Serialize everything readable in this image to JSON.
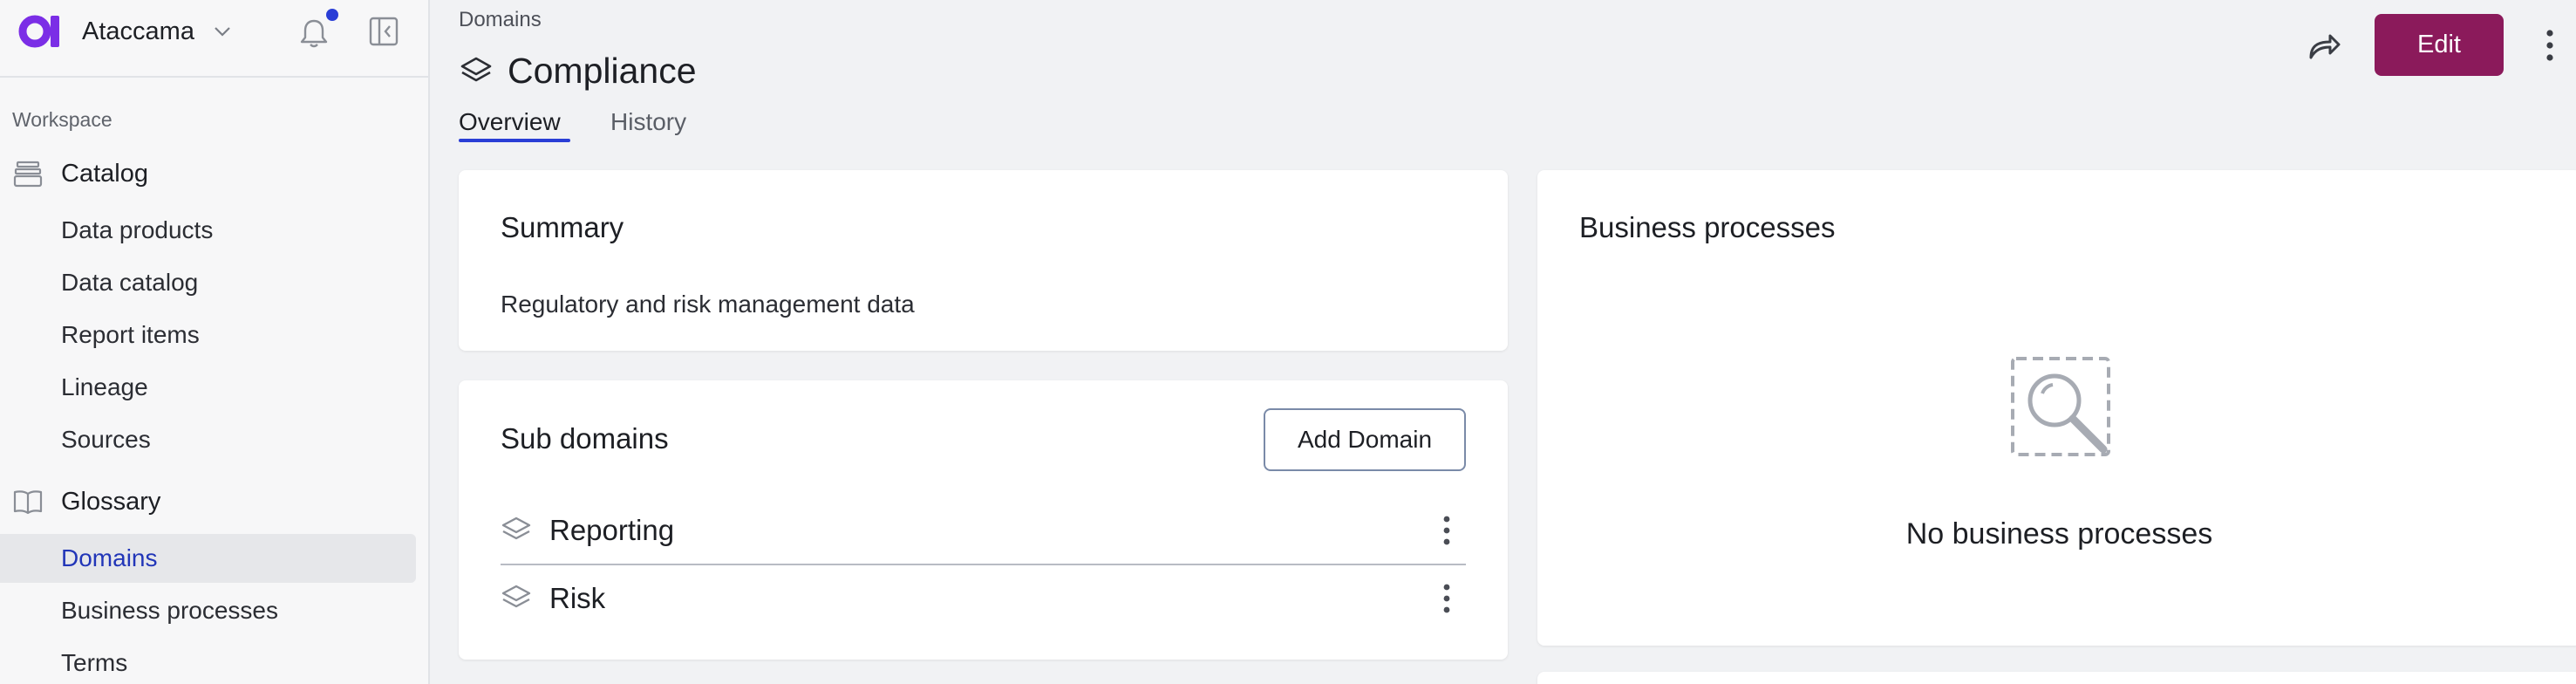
{
  "sidebar": {
    "org_name": "Ataccama",
    "workspace_label": "Workspace",
    "catalog": {
      "label": "Catalog",
      "items": [
        {
          "label": "Data products"
        },
        {
          "label": "Data catalog"
        },
        {
          "label": "Report items"
        },
        {
          "label": "Lineage"
        },
        {
          "label": "Sources"
        }
      ]
    },
    "glossary": {
      "label": "Glossary",
      "items": [
        {
          "label": "Domains",
          "active": true
        },
        {
          "label": "Business processes"
        },
        {
          "label": "Terms"
        }
      ]
    }
  },
  "header": {
    "breadcrumb": "Domains",
    "title": "Compliance",
    "tabs": [
      {
        "label": "Overview",
        "active": true
      },
      {
        "label": "History"
      }
    ],
    "edit_label": "Edit"
  },
  "summary": {
    "title": "Summary",
    "text": "Regulatory and risk management data"
  },
  "sub_domains": {
    "title": "Sub domains",
    "add_label": "Add Domain",
    "items": [
      {
        "label": "Reporting"
      },
      {
        "label": "Risk"
      }
    ]
  },
  "business_processes": {
    "title": "Business processes",
    "empty_text": "No business processes"
  },
  "colors": {
    "accent": "#2a3ed6",
    "primary_button": "#8b1a5b",
    "brand_logo": "#7b2ee6"
  }
}
